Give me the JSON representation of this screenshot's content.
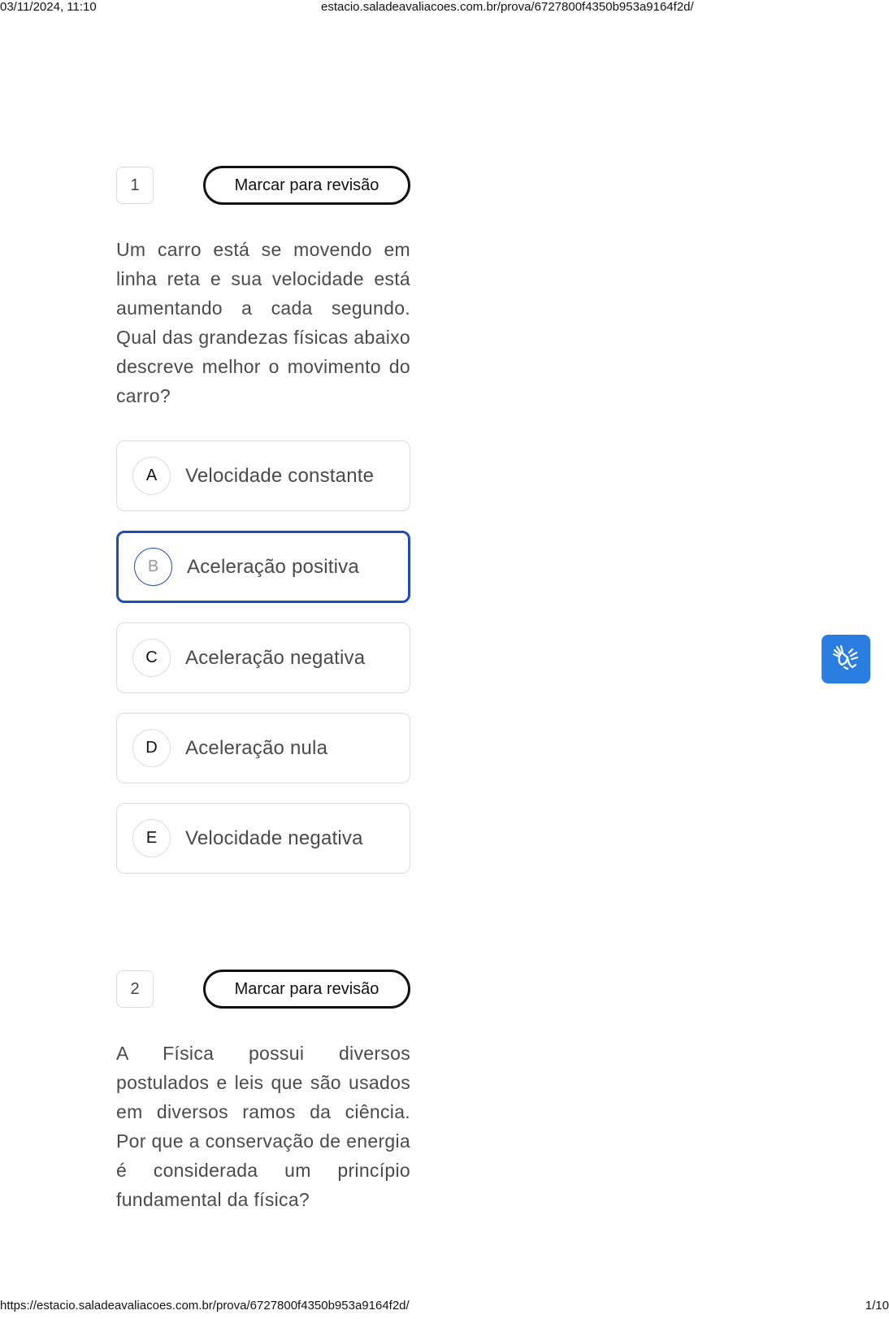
{
  "print": {
    "datetime": "03/11/2024, 11:10",
    "header_url": "estacio.saladeavaliacoes.com.br/prova/6727800f4350b953a9164f2d/",
    "footer_url": "https://estacio.saladeavaliacoes.com.br/prova/6727800f4350b953a9164f2d/",
    "page": "1/10"
  },
  "accessibility": {
    "icon": "sign-language-hands-icon",
    "color": "#2a7de1"
  },
  "questions": [
    {
      "number": "1",
      "review_label": "Marcar para revisão",
      "text": "Um carro está se movendo em linha reta e sua velocidade está aumentando a cada segundo. Qual das grandezas físicas abaixo descreve melhor o movimento do carro?",
      "options": [
        {
          "letter": "A",
          "label": "Velocidade constante"
        },
        {
          "letter": "B",
          "label": "Aceleração positiva",
          "selected": true
        },
        {
          "letter": "C",
          "label": "Aceleração negativa"
        },
        {
          "letter": "D",
          "label": "Aceleração nula"
        },
        {
          "letter": "E",
          "label": "Velocidade negativa"
        }
      ]
    },
    {
      "number": "2",
      "review_label": "Marcar para revisão",
      "text": "A Física possui diversos postulados e leis que são usados em diversos ramos da ciência. Por que a conservação de energia é considerada um princípio fundamental da física?"
    }
  ],
  "colors": {
    "selected_border": "#1f4db8",
    "option_border": "#dcdcdc",
    "text": "#4a4a4a"
  }
}
